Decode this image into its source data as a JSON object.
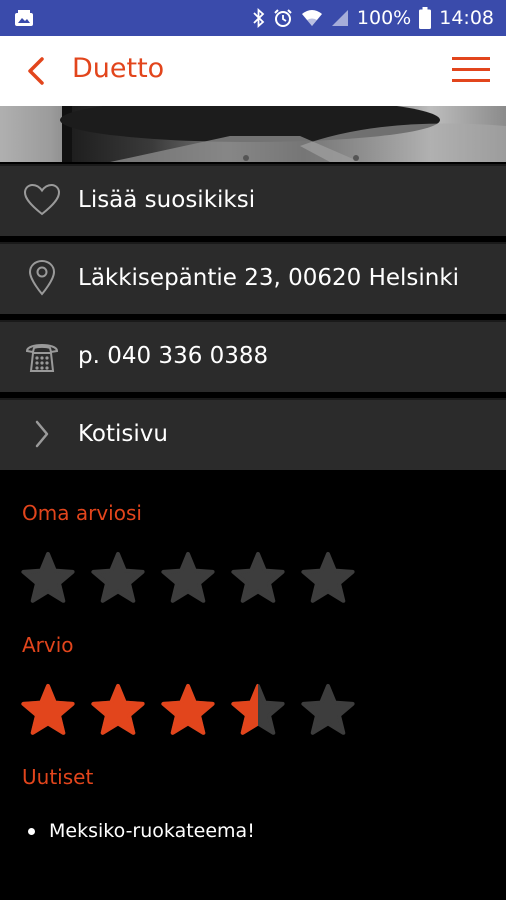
{
  "status_bar": {
    "battery_percent": "100%",
    "time": "14:08"
  },
  "app_bar": {
    "title": "Duetto"
  },
  "actions": {
    "favorite_label": "Lisää suosikiksi",
    "address": "Läkkisepäntie 23, 00620 Helsinki",
    "phone": "p. 040 336 0388",
    "homepage_label": "Kotisivu"
  },
  "ratings": {
    "own_rating_title": "Oma arviosi",
    "own_rating_value": 0,
    "rating_title": "Arvio",
    "rating_value": 3.5,
    "max_stars": 5
  },
  "news": {
    "title": "Uutiset",
    "items": [
      "Meksiko-ruokateema!"
    ]
  },
  "colors": {
    "accent": "#e2451c",
    "status_bar": "#3a4bab",
    "row_bg": "#2b2b2b",
    "star_empty": "#3d3d3d"
  }
}
